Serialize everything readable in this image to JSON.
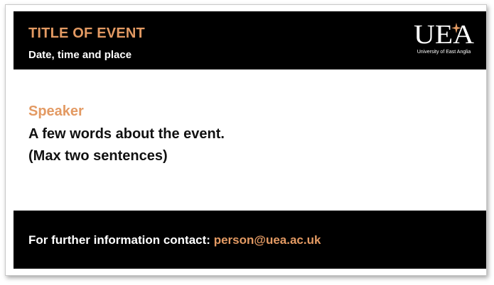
{
  "header": {
    "title": "TITLE OF EVENT",
    "subtitle": "Date, time and place",
    "logo": {
      "mark_text": "UEA",
      "caption": "University of East Anglia",
      "icon": "star-icon"
    }
  },
  "body": {
    "speaker_label": "Speaker",
    "description_line1": "A few words about the event.",
    "description_line2": "(Max two sentences)"
  },
  "footer": {
    "contact_label": "For further information contact:",
    "contact_email": "person@uea.ac.uk"
  },
  "colors": {
    "accent": "#e39a63",
    "band": "#000000",
    "text": "#111111",
    "background": "#ffffff"
  }
}
